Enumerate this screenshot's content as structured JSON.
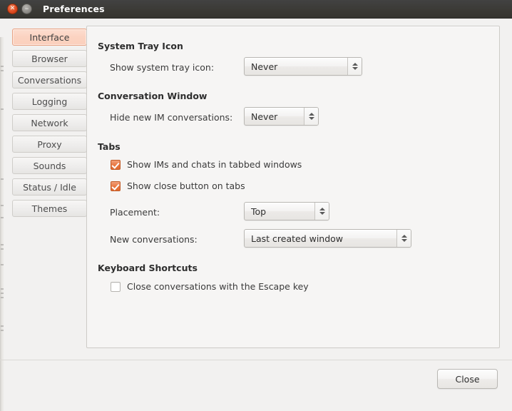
{
  "window": {
    "title": "Preferences",
    "close_icon": "window-close-icon",
    "minimize_icon": "window-minimize-icon",
    "close_glyph": "✕",
    "minimize_glyph": "–"
  },
  "sidebar": {
    "items": [
      {
        "label": "Interface",
        "active": true
      },
      {
        "label": "Browser",
        "active": false
      },
      {
        "label": "Conversations",
        "active": false
      },
      {
        "label": "Logging",
        "active": false
      },
      {
        "label": "Network",
        "active": false
      },
      {
        "label": "Proxy",
        "active": false
      },
      {
        "label": "Sounds",
        "active": false
      },
      {
        "label": "Status / Idle",
        "active": false
      },
      {
        "label": "Themes",
        "active": false
      }
    ]
  },
  "sections": {
    "system_tray": {
      "heading": "System Tray Icon",
      "tray_icon_label": "Show system tray icon:",
      "tray_icon_value": "Never"
    },
    "conversation_window": {
      "heading": "Conversation Window",
      "hide_im_label": "Hide new IM conversations:",
      "hide_im_value": "Never"
    },
    "tabs": {
      "heading": "Tabs",
      "show_tabbed_label": "Show IMs and chats in tabbed windows",
      "show_tabbed_checked": true,
      "show_close_label": "Show close button on tabs",
      "show_close_checked": true,
      "placement_label": "Placement:",
      "placement_value": "Top",
      "new_conversations_label": "New conversations:",
      "new_conversations_value": "Last created window"
    },
    "keyboard_shortcuts": {
      "heading": "Keyboard Shortcuts",
      "escape_label": "Close conversations with the Escape key",
      "escape_checked": false
    }
  },
  "footer": {
    "close_label": "Close"
  },
  "colors": {
    "titlebar": "#3c3b37",
    "accent_orange": "#e8763f",
    "active_tab_bg": "#fbd3c1",
    "active_tab_border": "#e8a283",
    "panel_bg": "#f6f5f4",
    "window_bg": "#f2f1f0"
  }
}
